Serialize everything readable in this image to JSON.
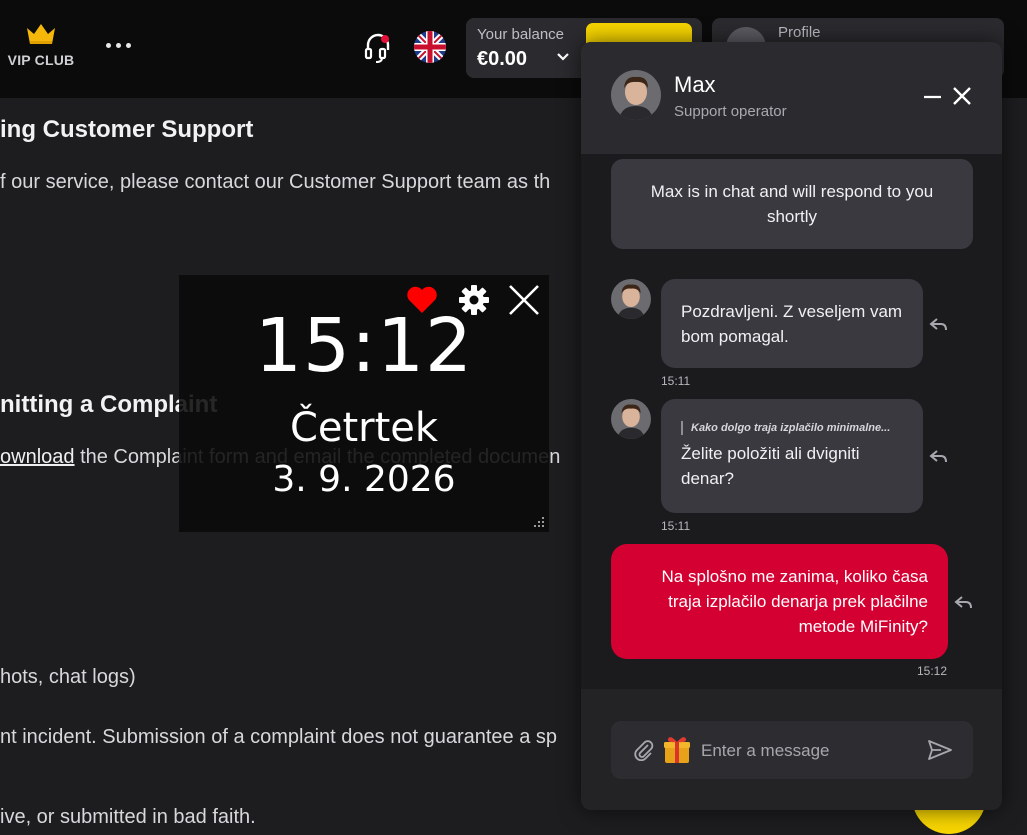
{
  "header": {
    "vip_label": "VIP CLUB",
    "balance_caption": "Your balance",
    "balance_amount": "€0.00",
    "profile_label": "Profile",
    "accent": "#f8d600"
  },
  "page": {
    "heading_support": "ing Customer Support",
    "support_line": "f our service, please contact our Customer Support team as th",
    "heading_complaint": "nitting a Complaint",
    "download_link": "ownload",
    "download_rest": " the Complaint form and email the completed documen",
    "line_evidence": "hots, chat logs)",
    "line_incident": "nt incident. Submission of a complaint does not guarantee a sp",
    "line_faith": "ive, or submitted in bad faith."
  },
  "clock_widget": {
    "time": "15:12",
    "day": "Četrtek",
    "date": "3. 9. 2026"
  },
  "chat": {
    "operator_name": "Max",
    "operator_role": "Support operator",
    "system_message": "Max is in chat and will respond to you shortly",
    "messages": [
      {
        "text": "Pozdravljeni. Z veseljem vam bom pomagal.",
        "time": "15:11"
      },
      {
        "quote": "Kako dolgo traja izplačilo minimalne...",
        "text": "Želite položiti ali dvigniti denar?",
        "time": "15:11"
      },
      {
        "text": "Na splošno me zanima, koliko časa traja izplačilo denarja prek plačilne metode MiFinity?",
        "time": "15:12"
      }
    ],
    "input_placeholder": "Enter a message",
    "user_bubble_color": "#d50032"
  }
}
